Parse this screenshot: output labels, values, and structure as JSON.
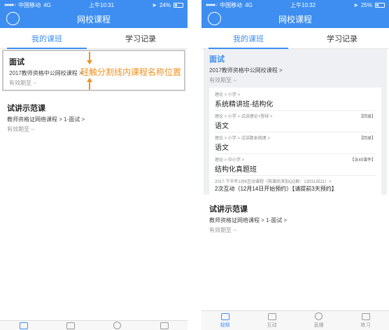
{
  "left": {
    "status": {
      "carrier": "中国移动",
      "network": "4G",
      "time": "上午10:31",
      "battery": "24%",
      "battery_level": 0.24
    },
    "nav": {
      "title": "网校课程"
    },
    "tabs": [
      "我的课班",
      "学习记录"
    ],
    "courses": [
      {
        "title": "面试",
        "sub": "2017教师资格中公网校课程 >",
        "expire": "有效期至 --"
      },
      {
        "title": "试讲示范课",
        "sub": "教师资格证网络课程 > 1-面试 >",
        "expire": "有效期至 --"
      }
    ],
    "annotation": "轻触分割线内课程名称位置"
  },
  "right": {
    "status": {
      "carrier": "中国移动",
      "network": "4G",
      "time": "上午10:32",
      "battery": "25%",
      "battery_level": 0.25
    },
    "nav": {
      "title": "网校课程"
    },
    "tabs": [
      "我的课班",
      "学习记录"
    ],
    "course1": {
      "title": "面试",
      "sub": "2017教师资格中公网校课程 >",
      "expire": "有效期至 --",
      "lessons": [
        {
          "path": "理论 > 小学 >",
          "name": "系统精讲班-结构化",
          "tag": ""
        },
        {
          "path": "理论 > 小学 > 试讲理论+答辩 >",
          "name": "语文",
          "tag": "【回录】"
        },
        {
          "path": "理论 > 小学 > 试讲题本梳理 >",
          "name": "语文",
          "tag": "【回录】"
        },
        {
          "path": "理论 > 中小学 >",
          "name": "结构化真题班",
          "tag": "【含49课件】"
        },
        {
          "path": "2017-下半年1对6互动课程（购课后添加QQ群：130313511）>",
          "name": "2次互动（12月14日开始预约）【请提前3天预约】",
          "tag": ""
        }
      ]
    },
    "course2": {
      "title": "试讲示范课",
      "sub": "教师资格证网络课程 > 1-面试 >",
      "expire": "有效期至 --"
    },
    "tabbar": [
      "视频",
      "互动",
      "直播",
      "练习"
    ]
  }
}
